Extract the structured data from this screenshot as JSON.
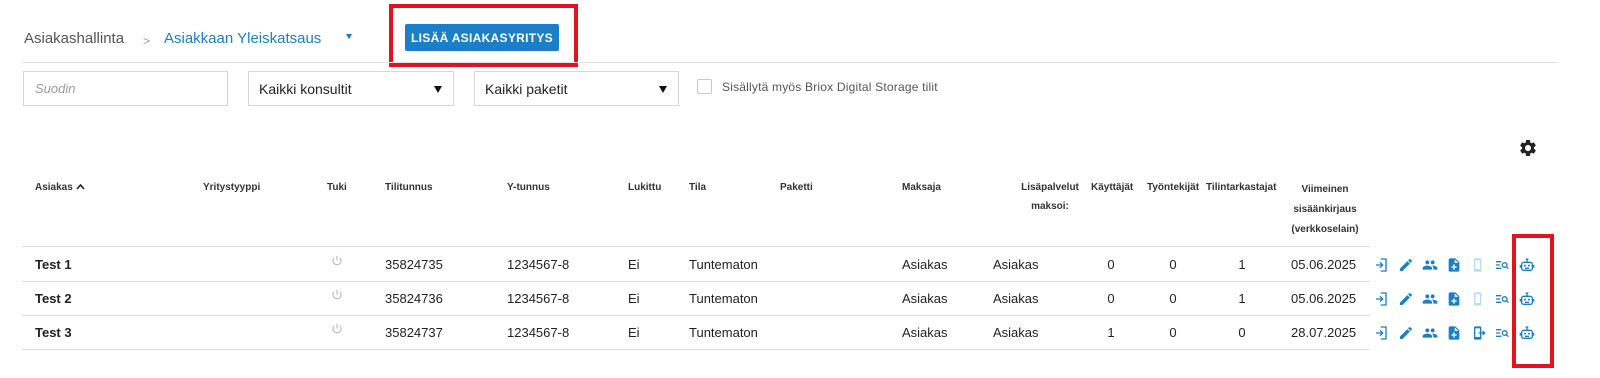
{
  "breadcrumb": {
    "root": "Asiakashallinta",
    "separator": ">",
    "current": "Asiakkaan Yleiskatsaus"
  },
  "toolbar": {
    "add_customer_label": "LISÄÄ ASIAKASYRITYS"
  },
  "filters": {
    "search_placeholder": "Suodin",
    "consultants_selected": "Kaikki konsultit",
    "packets_selected": "Kaikki paketit",
    "include_storage_label": "Sisällytä myös Briox Digital Storage tilit"
  },
  "table": {
    "headers": {
      "asiakas": "Asiakas",
      "yritystyyppi": "Yritystyyppi",
      "tuki": "Tuki",
      "tilitunnus": "Tilitunnus",
      "ytunnus": "Y-tunnus",
      "lukittu": "Lukittu",
      "tila": "Tila",
      "paketti": "Paketti",
      "maksaja": "Maksaja",
      "lisapalvelut_1": "Lisäpalvelut",
      "lisapalvelut_2": "maksoi:",
      "kayttajat": "Käyttäjät",
      "tyontekijat": "Työntekijät",
      "tilintarkastajat": "Tilintarkastajat",
      "viimeinen_1": "Viimeinen",
      "viimeinen_2": "sisäänkirjaus",
      "viimeinen_3": "(verkkoselain)"
    },
    "rows": [
      {
        "name": "Test 1",
        "account": "35824735",
        "business_id": "1234567-8",
        "locked": "Ei",
        "status": "Tuntematon",
        "payer": "Asiakas",
        "addons_paid_by": "Asiakas",
        "users": "0",
        "employees": "0",
        "auditors": "1",
        "last_login": "05.06.2025"
      },
      {
        "name": "Test 2",
        "account": "35824736",
        "business_id": "1234567-8",
        "locked": "Ei",
        "status": "Tuntematon",
        "payer": "Asiakas",
        "addons_paid_by": "Asiakas",
        "users": "0",
        "employees": "0",
        "auditors": "1",
        "last_login": "05.06.2025"
      },
      {
        "name": "Test 3",
        "account": "35824737",
        "business_id": "1234567-8",
        "locked": "Ei",
        "status": "Tuntematon",
        "payer": "Asiakas",
        "addons_paid_by": "Asiakas",
        "users": "1",
        "employees": "0",
        "auditors": "0",
        "last_login": "28.07.2025"
      }
    ],
    "row_icons": [
      "login-icon",
      "edit-icon",
      "users-icon",
      "add-document-icon",
      "mobile-logout-icon",
      "search-list-icon",
      "robot-icon"
    ]
  },
  "colors": {
    "accent": "#1a7fc7",
    "highlight": "#e0141e",
    "icon_disabled": "#b9dbf2"
  }
}
